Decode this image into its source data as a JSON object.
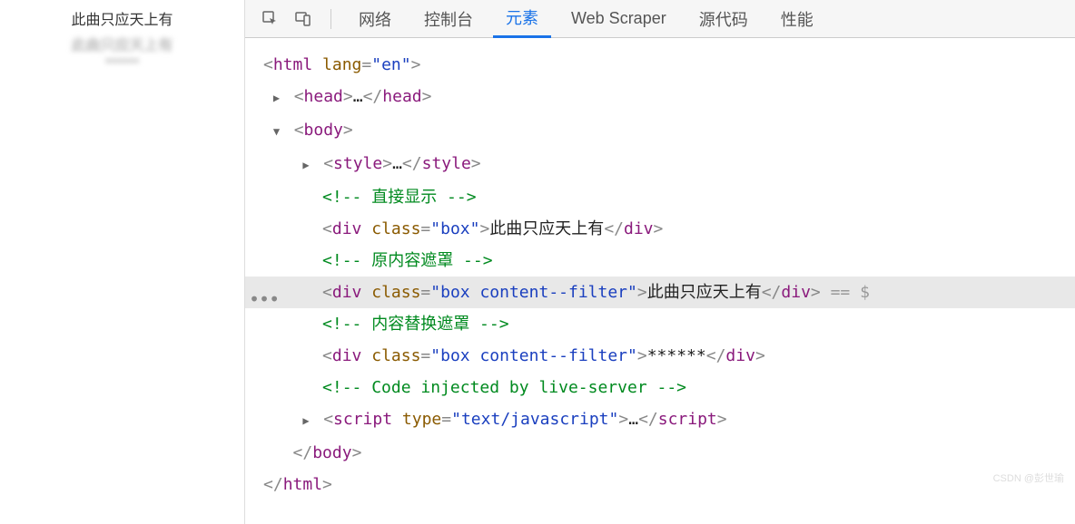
{
  "left": {
    "line1": "此曲只应天上有",
    "blur1": "此曲只应天上有",
    "blur2": "******"
  },
  "toolbar": {
    "tabs": {
      "network": "网络",
      "console": "控制台",
      "elements": "元素",
      "webscraper": "Web Scraper",
      "sources": "源代码",
      "performance": "性能"
    }
  },
  "dom": {
    "html_open": {
      "tag": "html",
      "attr": "lang",
      "val": "en"
    },
    "head": {
      "tag": "head",
      "ell": "…"
    },
    "body_open": {
      "tag": "body"
    },
    "style": {
      "tag": "style",
      "ell": "…"
    },
    "comment1": "<!-- 直接显示 -->",
    "div1": {
      "tag": "div",
      "attr": "class",
      "val": "box",
      "text": "此曲只应天上有"
    },
    "comment2": "<!-- 原内容遮罩 -->",
    "div2": {
      "tag": "div",
      "attr": "class",
      "val": "box content--filter",
      "text": "此曲只应天上有",
      "suffix": " == $"
    },
    "comment3": "<!-- 内容替换遮罩 -->",
    "div3": {
      "tag": "div",
      "attr": "class",
      "val": "box content--filter",
      "text": "******"
    },
    "comment4": "<!-- Code injected by live-server -->",
    "script": {
      "tag": "script",
      "attr": "type",
      "val": "text/javascript",
      "ell": "…"
    },
    "body_close": {
      "tag": "body"
    },
    "html_close": {
      "tag": "html"
    }
  },
  "watermark": "CSDN @彭世瑜"
}
